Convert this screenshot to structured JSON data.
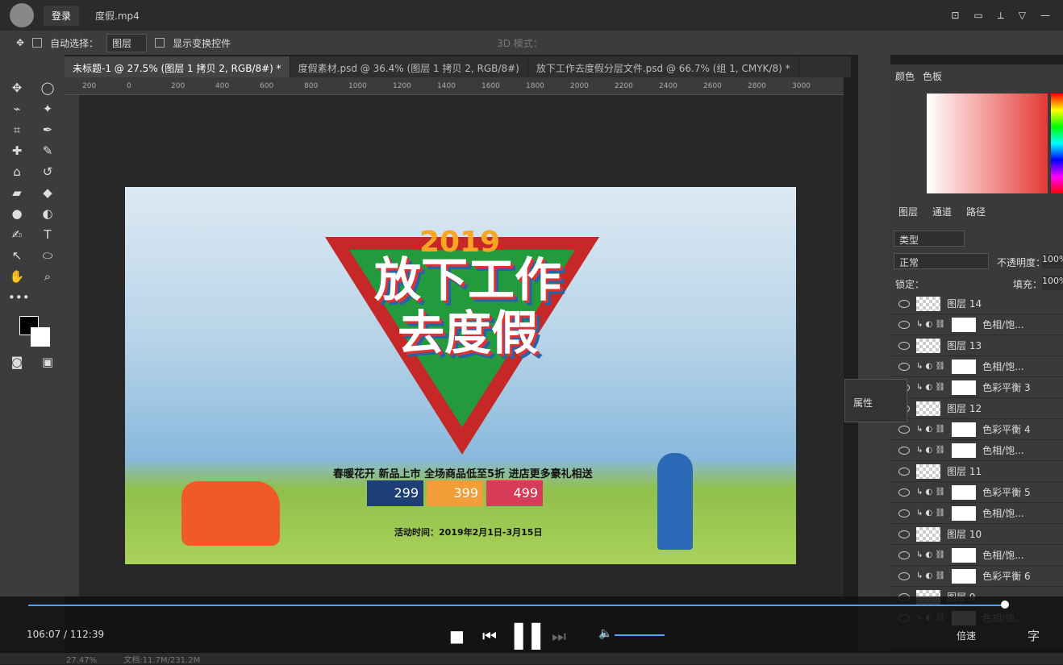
{
  "top": {
    "login": "登录",
    "video_title": "度假.mp4"
  },
  "options": {
    "auto_select": "自动选择：",
    "layer_select": "图层",
    "transform": "显示变换控件",
    "mode3d": "3D 模式："
  },
  "tabs": [
    "未标题-1 @ 27.5% (图层 1 拷贝 2, RGB/8#) *",
    "度假素材.psd @ 36.4% (图层 1 拷贝 2, RGB/8#)",
    "放下工作去度假分层文件.psd @ 66.7% (组 1, CMYK/8) *"
  ],
  "ruler": [
    "200",
    "0",
    "200",
    "400",
    "600",
    "800",
    "1000",
    "1200",
    "1400",
    "1600",
    "1800",
    "2000",
    "2200",
    "2400",
    "2600",
    "2800",
    "3000"
  ],
  "banner": {
    "year": "2019",
    "headline": "放下工作\n去度假",
    "subtitle": "春暖花开 新品上市 全场商品低至5折 进店更多豪礼相送",
    "prices": [
      "299",
      "399",
      "499"
    ],
    "date": "活动时间：2019年2月1日-3月15日"
  },
  "panel": {
    "tabs": [
      "颜色",
      "色板"
    ],
    "layer_tabs": [
      "图层",
      "通道",
      "路径"
    ],
    "kind": "类型",
    "blend": "正常",
    "opacity_label": "不透明度：",
    "opacity": "100%",
    "lock": "锁定：",
    "fill_label": "填充：",
    "fill": "100%",
    "props": "属性",
    "layers": [
      {
        "name": "图层 14",
        "type": "layer"
      },
      {
        "name": "色相/饱...",
        "type": "adj"
      },
      {
        "name": "图层 13",
        "type": "layer"
      },
      {
        "name": "色相/饱...",
        "type": "adj"
      },
      {
        "name": "色彩平衡 3",
        "type": "adj"
      },
      {
        "name": "图层 12",
        "type": "layer"
      },
      {
        "name": "色彩平衡 4",
        "type": "adj"
      },
      {
        "name": "色相/饱...",
        "type": "adj"
      },
      {
        "name": "图层 11",
        "type": "layer"
      },
      {
        "name": "色彩平衡 5",
        "type": "adj"
      },
      {
        "name": "色相/饱...",
        "type": "adj"
      },
      {
        "name": "图层 10",
        "type": "layer"
      },
      {
        "name": "色相/饱...",
        "type": "adj"
      },
      {
        "name": "色彩平衡 6",
        "type": "adj"
      },
      {
        "name": "图层 9",
        "type": "layer"
      },
      {
        "name": "色相/饱...",
        "type": "adj"
      }
    ]
  },
  "player": {
    "time": "106:07 / 112:39",
    "speed": "倍速",
    "subtitle": "字"
  },
  "status": {
    "zoom": "27.47%",
    "doc": "文档:11.7M/231.2M"
  }
}
